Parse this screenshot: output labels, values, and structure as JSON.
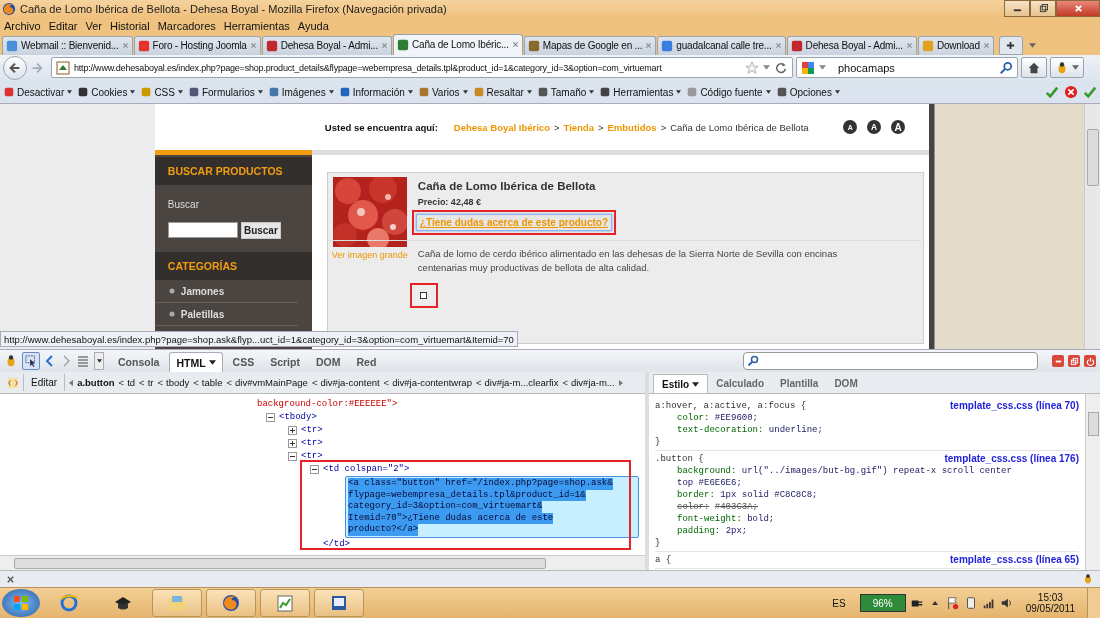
{
  "window": {
    "title": "Caña de Lomo Ibérica de Bellota - Dehesa Boyal - Mozilla Firefox (Navegación privada)"
  },
  "menu": [
    "Archivo",
    "Editar",
    "Ver",
    "Historial",
    "Marcadores",
    "Herramientas",
    "Ayuda"
  ],
  "tabs": [
    {
      "label": "Webmail :: Bienvenid...",
      "selected": false,
      "color": "#4a90d9"
    },
    {
      "label": "Foro - Hosting Joomla",
      "selected": false,
      "color": "#e8332a"
    },
    {
      "label": "Dehesa Boyal - Admi...",
      "selected": false,
      "color": "#c0282d"
    },
    {
      "label": "Caña de Lomo Ibéric...",
      "selected": true,
      "color": "#2e7d32"
    },
    {
      "label": "Mapas de Google en ...",
      "selected": false,
      "color": "#8a6a2a"
    },
    {
      "label": "guadalcanal calle tre...",
      "selected": false,
      "color": "#3b7ddd"
    },
    {
      "label": "Dehesa Boyal - Admi...",
      "selected": false,
      "color": "#c0282d"
    },
    {
      "label": "Download",
      "selected": false,
      "color": "#e0a020"
    }
  ],
  "nav": {
    "url": "http://www.dehesaboyal.es/index.php?page=shop.product_details&flypage=webempresa_details.tpl&product_id=1&category_id=3&option=com_virtuemart",
    "search": "phocamaps"
  },
  "devbar": [
    "Desactivar",
    "Cookies",
    "CSS",
    "Formularios",
    "Imágenes",
    "Información",
    "Varios",
    "Resaltar",
    "Tamaño",
    "Herramientas",
    "Código fuente",
    "Opciones"
  ],
  "page": {
    "here_label": "Usted se encuentra aquí:",
    "crumbs": [
      {
        "text": "Dehesa Boyal Ibérico",
        "kind": "link"
      },
      {
        "sep": ">",
        "text": "Tienda",
        "kind": "link"
      },
      {
        "sep": ">",
        "text": "Embutidos",
        "kind": "link"
      },
      {
        "sep": ">",
        "text": "Caña de Lomo Ibérica de Bellota",
        "kind": "current"
      }
    ],
    "font_buttons": [
      "A",
      "A",
      "A"
    ],
    "search_heading": "BUSCAR PRODUCTOS",
    "search_label": "Buscar",
    "search_button": "Buscar",
    "categories_heading": "CATEGORÍAS",
    "categories": [
      "Jamones",
      "Paletillas"
    ],
    "product": {
      "title": "Caña de Lomo Ibérica de Bellota",
      "price": "Precio: 42,48 €",
      "ask": "¿Tiene dudas acerca de este producto?",
      "image_link": "Ver imagen grande",
      "description": "Caña de lomo de cerdo ibérico alimentado en las dehesas de la Sierra Norte de Sevilla con encinas centenarias muy productivas de bellota de alta calidad."
    },
    "status_url": "http://www.dehesaboyal.es/index.php?page=shop.ask&flyp...uct_id=1&category_id=3&option=com_virtuemart&Itemid=70"
  },
  "firebug": {
    "tabs": [
      {
        "label": "Consola",
        "selected": false
      },
      {
        "label": "HTML",
        "selected": true
      },
      {
        "label": "CSS",
        "selected": false
      },
      {
        "label": "Script",
        "selected": false
      },
      {
        "label": "DOM",
        "selected": false
      },
      {
        "label": "Red",
        "selected": false
      }
    ],
    "edit": "Editar",
    "path": [
      {
        "label": "a.button",
        "selected": true
      },
      {
        "sep": "<",
        "label": "td",
        "selected": false
      },
      {
        "sep": "<",
        "label": "tr",
        "selected": false
      },
      {
        "sep": "<",
        "label": "tbody",
        "selected": false
      },
      {
        "sep": "<",
        "label": "table",
        "selected": false
      },
      {
        "sep": "<",
        "label": "div#vmMainPage",
        "selected": false
      },
      {
        "sep": "<",
        "label": "div#ja-content",
        "selected": false
      },
      {
        "sep": "<",
        "label": "div#ja-contentwrap",
        "selected": false
      },
      {
        "sep": "<",
        "label": "div#ja-m...clearfix",
        "selected": false
      },
      {
        "sep": "<",
        "label": "div#ja-m...",
        "selected": false
      }
    ],
    "partial_line": "background-color:#EEEEEE\">",
    "nodes": [
      {
        "tag": "<tbody>",
        "expanded": true,
        "children": [
          {
            "tag": "<tr>",
            "expanded": false
          },
          {
            "tag": "<tr>",
            "expanded": false
          },
          {
            "tag": "<tr>",
            "expanded": true,
            "children": [
              {
                "tag": "<td colspan=\"2\">",
                "expanded": true,
                "close": "</td>",
                "children": [
                  {
                    "kind": "element",
                    "selected": true,
                    "lines": [
                      "<a class=\"button\" href=\"/index.php?page=shop.ask&",
                      "flypage=webempresa_details.tpl&product_id=1&",
                      "category_id=3&option=com_virtuemart&",
                      "Itemid=70\">¿Tiene dudas acerca de este",
                      "producto?</a>"
                    ]
                  }
                ]
              }
            ]
          }
        ]
      }
    ],
    "style_tabs": [
      {
        "label": "Estilo",
        "selected": true
      },
      {
        "label": "Calculado",
        "selected": false
      },
      {
        "label": "Plantilla",
        "selected": false
      },
      {
        "label": "DOM",
        "selected": false
      }
    ],
    "rules": [
      {
        "selector": "a:hover, a:active, a:focus {",
        "source": "template_css.css (línea 70)",
        "close": "}",
        "declarations": [
          {
            "prop": "color:",
            "value": "#EE9600;",
            "overridden": false
          },
          {
            "prop": "text-decoration:",
            "value": "underline;",
            "overridden": false
          }
        ]
      },
      {
        "selector": ".button {",
        "source": "template_css.css (línea 176)",
        "close": "}",
        "declarations": [
          {
            "prop": "background:",
            "value": "url(\"../images/but-bg.gif\") repeat-x scroll center top #E6E6E6;",
            "overridden": false
          },
          {
            "prop": "border:",
            "value": "1px solid #C8C8C8;",
            "overridden": false
          },
          {
            "prop": "color:",
            "value": "#403C3A;",
            "overridden": true
          },
          {
            "prop": "font-weight:",
            "value": "bold;",
            "overridden": false
          },
          {
            "prop": "padding:",
            "value": "2px;",
            "overridden": false
          }
        ]
      },
      {
        "selector": "a {",
        "source": "template_css.css (línea 65)"
      }
    ]
  },
  "taskbar": {
    "language": "ES",
    "battery": "96%",
    "time": "15:03",
    "date": "09/05/2011"
  }
}
